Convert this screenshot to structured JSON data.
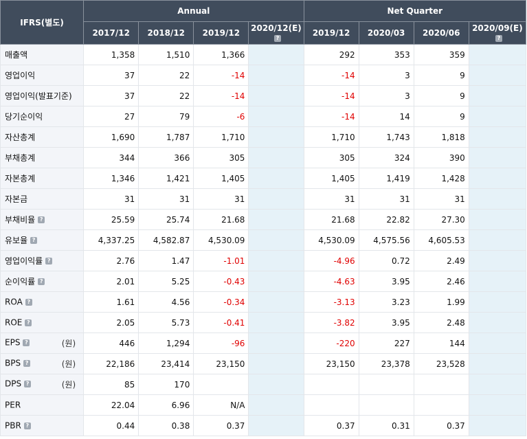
{
  "header": {
    "ifrs_label": "IFRS(별도)",
    "annual_label": "Annual",
    "quarter_label": "Net Quarter",
    "periods": [
      "2017/12",
      "2018/12",
      "2019/12",
      "2020/12(E)",
      "2019/12",
      "2020/03",
      "2020/06",
      "2020/09(E)"
    ],
    "estimate_columns": [
      3,
      7
    ]
  },
  "rows": [
    {
      "label": "매출액",
      "help": false,
      "unit": "",
      "values": [
        "1,358",
        "1,510",
        "1,366",
        "",
        "292",
        "353",
        "359",
        ""
      ],
      "negative": [
        false,
        false,
        false,
        false,
        false,
        false,
        false,
        false
      ]
    },
    {
      "label": "영업이익",
      "help": false,
      "unit": "",
      "values": [
        "37",
        "22",
        "-14",
        "",
        "-14",
        "3",
        "9",
        ""
      ],
      "negative": [
        false,
        false,
        true,
        false,
        true,
        false,
        false,
        false
      ]
    },
    {
      "label": "영업이익(발표기준)",
      "help": false,
      "unit": "",
      "values": [
        "37",
        "22",
        "-14",
        "",
        "-14",
        "3",
        "9",
        ""
      ],
      "negative": [
        false,
        false,
        true,
        false,
        true,
        false,
        false,
        false
      ]
    },
    {
      "label": "당기순이익",
      "help": false,
      "unit": "",
      "values": [
        "27",
        "79",
        "-6",
        "",
        "-14",
        "14",
        "9",
        ""
      ],
      "negative": [
        false,
        false,
        true,
        false,
        true,
        false,
        false,
        false
      ]
    },
    {
      "label": "자산총계",
      "help": false,
      "unit": "",
      "values": [
        "1,690",
        "1,787",
        "1,710",
        "",
        "1,710",
        "1,743",
        "1,818",
        ""
      ],
      "negative": [
        false,
        false,
        false,
        false,
        false,
        false,
        false,
        false
      ]
    },
    {
      "label": "부채총계",
      "help": false,
      "unit": "",
      "values": [
        "344",
        "366",
        "305",
        "",
        "305",
        "324",
        "390",
        ""
      ],
      "negative": [
        false,
        false,
        false,
        false,
        false,
        false,
        false,
        false
      ]
    },
    {
      "label": "자본총계",
      "help": false,
      "unit": "",
      "values": [
        "1,346",
        "1,421",
        "1,405",
        "",
        "1,405",
        "1,419",
        "1,428",
        ""
      ],
      "negative": [
        false,
        false,
        false,
        false,
        false,
        false,
        false,
        false
      ]
    },
    {
      "label": "자본금",
      "help": false,
      "unit": "",
      "values": [
        "31",
        "31",
        "31",
        "",
        "31",
        "31",
        "31",
        ""
      ],
      "negative": [
        false,
        false,
        false,
        false,
        false,
        false,
        false,
        false
      ]
    },
    {
      "label": "부채비율",
      "help": true,
      "unit": "",
      "values": [
        "25.59",
        "25.74",
        "21.68",
        "",
        "21.68",
        "22.82",
        "27.30",
        ""
      ],
      "negative": [
        false,
        false,
        false,
        false,
        false,
        false,
        false,
        false
      ]
    },
    {
      "label": "유보율",
      "help": true,
      "unit": "",
      "values": [
        "4,337.25",
        "4,582.87",
        "4,530.09",
        "",
        "4,530.09",
        "4,575.56",
        "4,605.53",
        ""
      ],
      "negative": [
        false,
        false,
        false,
        false,
        false,
        false,
        false,
        false
      ]
    },
    {
      "label": "영업이익률",
      "help": true,
      "unit": "",
      "values": [
        "2.76",
        "1.47",
        "-1.01",
        "",
        "-4.96",
        "0.72",
        "2.49",
        ""
      ],
      "negative": [
        false,
        false,
        true,
        false,
        true,
        false,
        false,
        false
      ]
    },
    {
      "label": "순이익률",
      "help": true,
      "unit": "",
      "values": [
        "2.01",
        "5.25",
        "-0.43",
        "",
        "-4.63",
        "3.95",
        "2.46",
        ""
      ],
      "negative": [
        false,
        false,
        true,
        false,
        true,
        false,
        false,
        false
      ]
    },
    {
      "label": "ROA",
      "help": true,
      "unit": "",
      "values": [
        "1.61",
        "4.56",
        "-0.34",
        "",
        "-3.13",
        "3.23",
        "1.99",
        ""
      ],
      "negative": [
        false,
        false,
        true,
        false,
        true,
        false,
        false,
        false
      ]
    },
    {
      "label": "ROE",
      "help": true,
      "unit": "",
      "values": [
        "2.05",
        "5.73",
        "-0.41",
        "",
        "-3.82",
        "3.95",
        "2.48",
        ""
      ],
      "negative": [
        false,
        false,
        true,
        false,
        true,
        false,
        false,
        false
      ]
    },
    {
      "label": "EPS",
      "help": true,
      "unit": "(원)",
      "values": [
        "446",
        "1,294",
        "-96",
        "",
        "-220",
        "227",
        "144",
        ""
      ],
      "negative": [
        false,
        false,
        true,
        false,
        true,
        false,
        false,
        false
      ]
    },
    {
      "label": "BPS",
      "help": true,
      "unit": "(원)",
      "values": [
        "22,186",
        "23,414",
        "23,150",
        "",
        "23,150",
        "23,378",
        "23,528",
        ""
      ],
      "negative": [
        false,
        false,
        false,
        false,
        false,
        false,
        false,
        false
      ]
    },
    {
      "label": "DPS",
      "help": true,
      "unit": "(원)",
      "values": [
        "85",
        "170",
        "",
        "",
        "",
        "",
        "",
        ""
      ],
      "negative": [
        false,
        false,
        false,
        false,
        false,
        false,
        false,
        false
      ]
    },
    {
      "label": "PER",
      "help": false,
      "unit": "",
      "values": [
        "22.04",
        "6.96",
        "N/A",
        "",
        "",
        "",
        "",
        ""
      ],
      "negative": [
        false,
        false,
        false,
        false,
        false,
        false,
        false,
        false
      ]
    },
    {
      "label": "PBR",
      "help": true,
      "unit": "",
      "values": [
        "0.44",
        "0.38",
        "0.37",
        "",
        "0.37",
        "0.31",
        "0.37",
        ""
      ],
      "negative": [
        false,
        false,
        false,
        false,
        false,
        false,
        false,
        false
      ]
    }
  ],
  "help_icon": "question-icon",
  "colors": {
    "header_bg": "#404c5c",
    "label_bg": "#f3f5f9",
    "estimate_bg": "#e6f2f8",
    "negative": "#e00000"
  }
}
